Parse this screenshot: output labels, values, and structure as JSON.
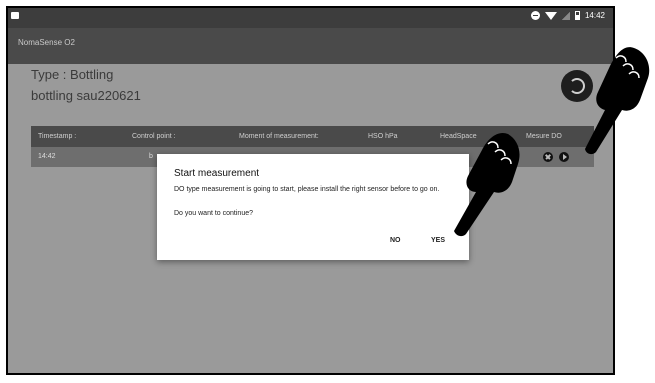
{
  "status_bar": {
    "time": "14:42"
  },
  "app_bar": {
    "title": "NomaSense O2"
  },
  "header": {
    "type_line": "Type : Bottling",
    "batch_name": "bottling sau220621"
  },
  "table": {
    "columns": [
      "Timestamp :",
      "Control point :",
      "Moment of measurement:",
      "HSO hPa",
      "HeadSpace",
      "Mesure DO"
    ],
    "rows": [
      {
        "timestamp": "14:42",
        "control_point": "b"
      }
    ]
  },
  "dialog": {
    "title": "Start measurement",
    "message": "DO type measurement is going to start, please install the right sensor before to go on.",
    "question": " Do you want to continue?",
    "no_label": "NO",
    "yes_label": "YES"
  },
  "icons": {
    "statusbar_left": "app-notification-icon",
    "fab": "refresh-icon",
    "row_actions": [
      "close-icon",
      "play-icon"
    ],
    "overlay": [
      "pointing-hand-icon",
      "pointing-hand-icon"
    ]
  }
}
